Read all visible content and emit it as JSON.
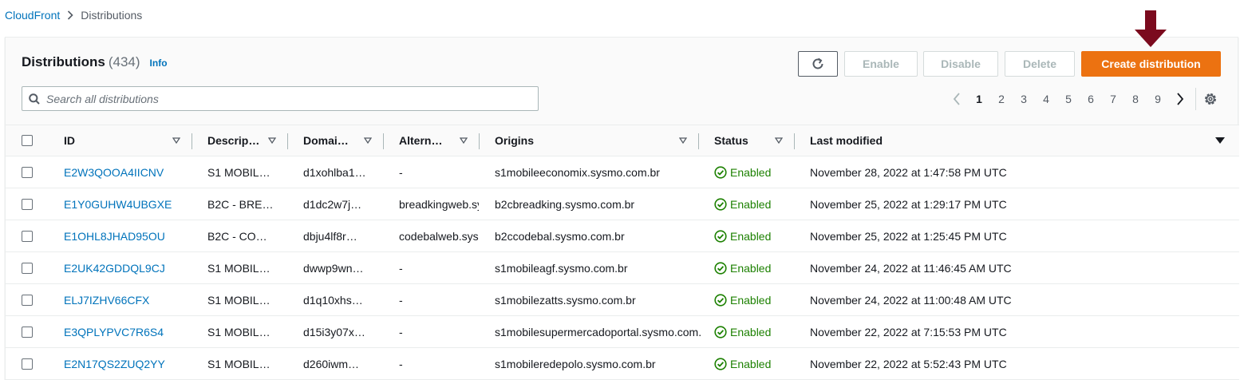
{
  "breadcrumb": {
    "root": "CloudFront",
    "current": "Distributions"
  },
  "header": {
    "title": "Distributions",
    "count": "(434)",
    "info": "Info"
  },
  "actions": {
    "enable": "Enable",
    "disable": "Disable",
    "delete": "Delete",
    "create": "Create distribution"
  },
  "search": {
    "placeholder": "Search all distributions"
  },
  "pagination": {
    "pages": [
      "1",
      "2",
      "3",
      "4",
      "5",
      "6",
      "7",
      "8",
      "9"
    ],
    "current": "1"
  },
  "table": {
    "columns": [
      "ID",
      "Descrip…",
      "Domai…",
      "Altern…",
      "Origins",
      "Status",
      "Last modified"
    ],
    "rows": [
      {
        "id": "E2W3QOOA4IICNV",
        "description": "S1 MOBIL…",
        "domain": "d1xohlba1…",
        "alternate": "-",
        "origins": "s1mobileeconomix.sysmo.com.br",
        "status": "Enabled",
        "modified": "November 28, 2022 at 1:47:58 PM UTC"
      },
      {
        "id": "E1Y0GUHW4UBGXE",
        "description": "B2C - BRE…",
        "domain": "d1dc2w7j…",
        "alternate": "breadkingweb.sy",
        "origins": "b2cbreadking.sysmo.com.br",
        "status": "Enabled",
        "modified": "November 25, 2022 at 1:29:17 PM UTC"
      },
      {
        "id": "E1OHL8JHAD95OU",
        "description": "B2C - CO…",
        "domain": "dbju4lf8r…",
        "alternate": "codebalweb.sysr",
        "origins": "b2ccodebal.sysmo.com.br",
        "status": "Enabled",
        "modified": "November 25, 2022 at 1:25:45 PM UTC"
      },
      {
        "id": "E2UK42GDDQL9CJ",
        "description": "S1 MOBIL…",
        "domain": "dwwp9wn…",
        "alternate": "-",
        "origins": "s1mobileagf.sysmo.com.br",
        "status": "Enabled",
        "modified": "November 24, 2022 at 11:46:45 AM UTC"
      },
      {
        "id": "ELJ7IZHV66CFX",
        "description": "S1 MOBIL…",
        "domain": "d1q10xhs…",
        "alternate": "-",
        "origins": "s1mobilezatts.sysmo.com.br",
        "status": "Enabled",
        "modified": "November 24, 2022 at 11:00:48 AM UTC"
      },
      {
        "id": "E3QPLYPVC7R6S4",
        "description": "S1 MOBIL…",
        "domain": "d15i3y07x…",
        "alternate": "-",
        "origins": "s1mobilesupermercadoportal.sysmo.com.",
        "status": "Enabled",
        "modified": "November 22, 2022 at 7:15:53 PM UTC"
      },
      {
        "id": "E2N17QS2ZUQ2YY",
        "description": "S1 MOBIL…",
        "domain": "d260iwm…",
        "alternate": "-",
        "origins": "s1mobileredepolo.sysmo.com.br",
        "status": "Enabled",
        "modified": "November 22, 2022 at 5:52:43 PM UTC"
      }
    ]
  },
  "colors": {
    "link": "#0073bb",
    "primary": "#ec7211",
    "success": "#1d8102",
    "annotation_arrow": "#7b0a1e"
  },
  "icons": {
    "refresh": "refresh-icon",
    "search": "search-icon",
    "settings": "gear-icon",
    "status": "check-circle-icon",
    "sort": "caret-down-icon"
  }
}
